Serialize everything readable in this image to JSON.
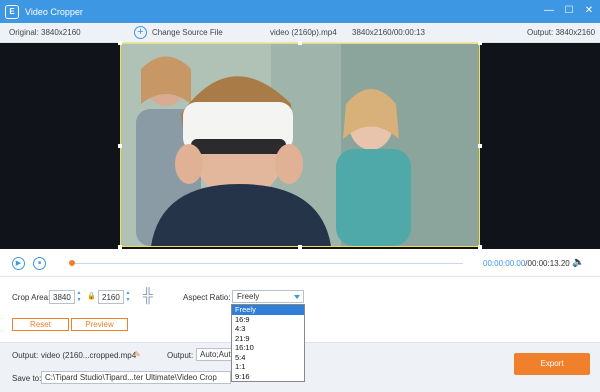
{
  "window": {
    "title": "Video Cropper",
    "app_icon": "E",
    "controls": {
      "minimize": "—",
      "maximize": "☐",
      "close": "✕"
    }
  },
  "info_bar": {
    "original_label": "Original: 3840x2160",
    "change_source_label": "Change Source File",
    "add_icon": "+",
    "file_name": "video (2160p).mp4",
    "file_meta": "3840x2160/00:00:13",
    "output_label": "Output: 3840x2160"
  },
  "playback": {
    "play_icon": "▶",
    "stop_icon": "■",
    "progress": 0.0,
    "current_time": "00:00:00.00",
    "total_time": "/00:00:13.20",
    "volume_icon": "🔈"
  },
  "crop": {
    "area_label": "Crop Area:",
    "width": "3840",
    "height": "2160",
    "up_arrow": "▲",
    "down_arrow": "▼",
    "lock_icon": "🔒",
    "center_icon": "╬",
    "aspect_label": "Aspect Ratio:",
    "aspect_selected": "Freely",
    "aspect_options": [
      "Freely",
      "16:9",
      "4:3",
      "21:9",
      "16:10",
      "5:4",
      "1:1",
      "9:16"
    ]
  },
  "buttons": {
    "reset": "Reset",
    "preview": "Preview",
    "export": "Export"
  },
  "output": {
    "output_label": "Output:",
    "output_file": "video (2160...cropped.mp4",
    "edit_icon": "✎",
    "format_label": "Output:",
    "format_value": "Auto;Auto",
    "save_label": "Save to:",
    "save_path": "C:\\Tipard Studio\\Tipard...ter Ultimate\\Video Crop"
  },
  "colors": {
    "accent": "#3d97e3",
    "orange": "#f0802c",
    "crop_frame": "#f4e04a"
  }
}
